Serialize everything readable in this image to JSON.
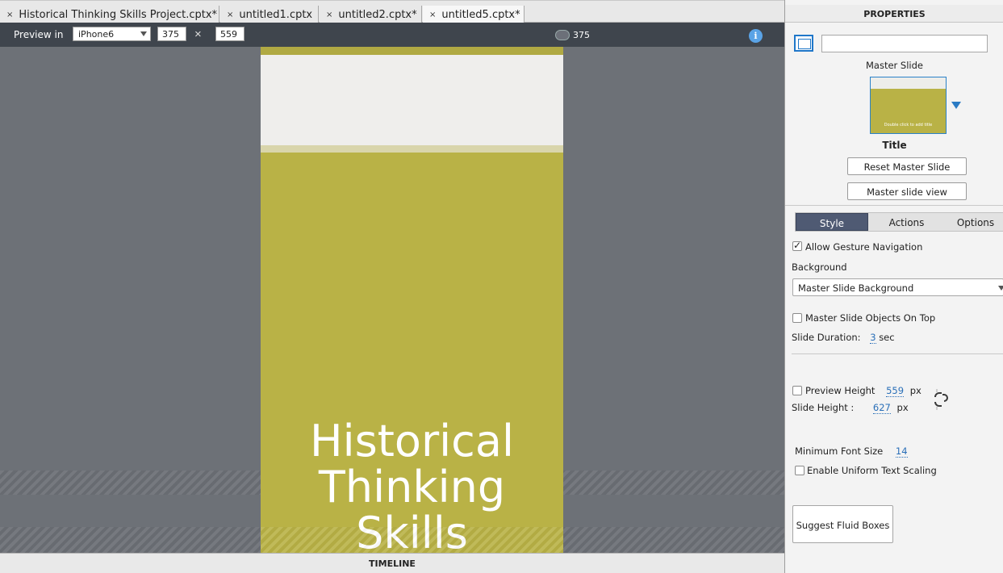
{
  "tabs": [
    {
      "label": "Historical Thinking Skills Project.cptx*",
      "close": "×"
    },
    {
      "label": "untitled1.cptx",
      "close": "×"
    },
    {
      "label": "untitled2.cptx*",
      "close": "×"
    },
    {
      "label": "untitled5.cptx*",
      "close": "×"
    }
  ],
  "toolbar": {
    "preview_label": "Preview in",
    "device": "iPhone6",
    "width": "375",
    "height": "559",
    "times_symbol": "×",
    "ruler_value": "375",
    "info_symbol": "i"
  },
  "slide": {
    "title": "Historical\nThinking\nSkills",
    "colors": {
      "olive": "#b9b246",
      "texture": "#efeeec"
    }
  },
  "timeline": {
    "label": "TIMELINE"
  },
  "properties": {
    "header": "PROPERTIES",
    "name_value": "",
    "master_slide_caption": "Master Slide",
    "thumbnail_text": "Double click to add title",
    "thumbnail_caption": "Title",
    "reset_button": "Reset Master Slide",
    "view_button": "Master slide view",
    "tabs": [
      "Style",
      "Actions",
      "Options"
    ],
    "allow_gesture": {
      "label": "Allow Gesture Navigation",
      "checked": true
    },
    "background_label": "Background",
    "background_value": "Master Slide Background",
    "master_on_top": {
      "label": "Master Slide Objects On Top",
      "checked": false
    },
    "slide_duration": {
      "label": "Slide Duration:",
      "value": "3",
      "unit": "sec"
    },
    "preview_height": {
      "label": "Preview Height",
      "value": "559",
      "unit": "px",
      "checked": false
    },
    "slide_height": {
      "label": "Slide Height :",
      "value": "627",
      "unit": "px"
    },
    "min_font": {
      "label": "Minimum Font Size",
      "value": "14"
    },
    "uniform_scaling": {
      "label": "Enable Uniform Text Scaling",
      "checked": false
    },
    "suggest_button": "Suggest Fluid Boxes"
  }
}
